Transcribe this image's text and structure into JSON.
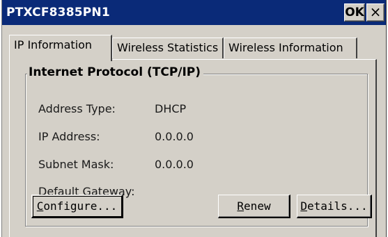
{
  "window": {
    "title": "PTXCF8385PN1",
    "ok_label": "OK",
    "close_label": "×"
  },
  "tabs": [
    {
      "label": "IP Information",
      "active": true
    },
    {
      "label": "Wireless Statistics",
      "active": false
    },
    {
      "label": "Wireless Information",
      "active": false
    }
  ],
  "group": {
    "title": "Internet Protocol (TCP/IP)",
    "rows": [
      {
        "label": "Address Type:",
        "value": "DHCP"
      },
      {
        "label": "IP Address:",
        "value": "0.0.0.0"
      },
      {
        "label": "Subnet Mask:",
        "value": "0.0.0.0"
      },
      {
        "label": "Default Gateway:",
        "value": ""
      }
    ]
  },
  "buttons": {
    "configure": {
      "mnemonic": "C",
      "rest": "onfigure..."
    },
    "renew": {
      "mnemonic": "R",
      "rest": "enew"
    },
    "details": {
      "mnemonic": "D",
      "rest": "etails..."
    }
  }
}
